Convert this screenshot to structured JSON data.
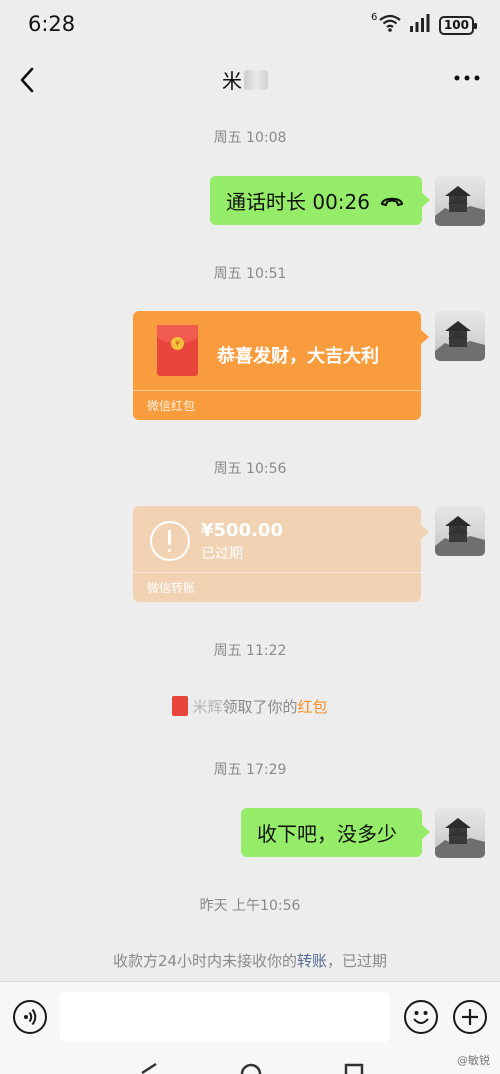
{
  "status_bar": {
    "time": "6:28",
    "network_sup": "6",
    "battery": "100"
  },
  "header": {
    "contact_name": "米"
  },
  "messages": {
    "ts1": "周五 10:08",
    "call_text": "通话时长 00:26",
    "ts2": "周五 10:51",
    "redpacket_wish": "恭喜发财，大吉大利",
    "redpacket_footer": "微信红包",
    "ts3": "周五 10:56",
    "transfer_amount": "¥500.00",
    "transfer_status": "已过期",
    "transfer_footer": "微信转账",
    "ts4": "周五 11:22",
    "system_claim_name": "米辉",
    "system_claim_text": "领取了你的",
    "system_claim_link": "红包",
    "ts5": "周五 17:29",
    "text_message": "收下吧，没多少",
    "ts6": "昨天 上午10:56",
    "system_expire_text": "收款方24小时内未接收你的",
    "system_expire_link": "转账",
    "system_expire_tail": "，已过期"
  },
  "watermark": "@敏锐",
  "colors": {
    "chat_bg": "#ededed",
    "sent_bubble": "#95ec69",
    "red_packet": "#f89c3d",
    "transfer_expired": "#f1d2b3",
    "link_blue": "#576b95",
    "link_orange": "#f58e27"
  },
  "icons": [
    "back-arrow-icon",
    "more-icon",
    "phone-hangup-icon",
    "red-packet-icon",
    "warning-circle-icon",
    "voice-icon",
    "emoji-icon",
    "plus-icon",
    "nav-back-icon",
    "nav-home-icon",
    "nav-recents-icon",
    "wifi-icon",
    "signal-icon",
    "battery-icon"
  ]
}
